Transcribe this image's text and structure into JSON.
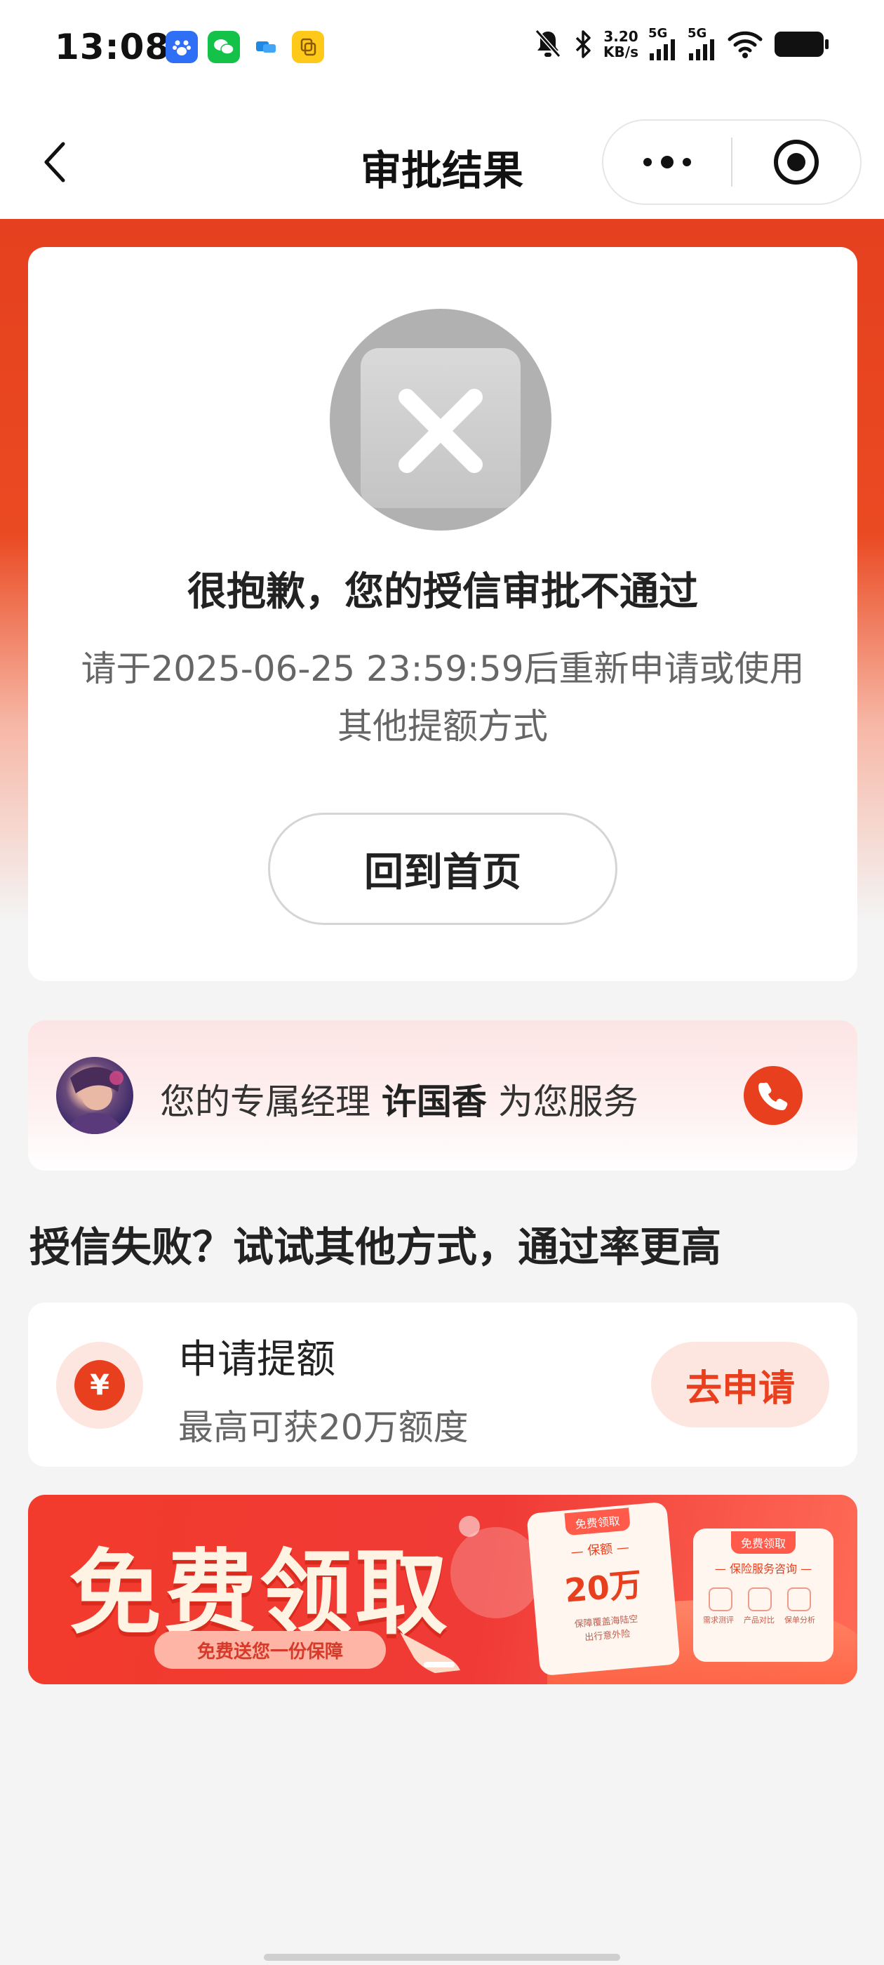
{
  "status_bar": {
    "time": "13:08",
    "speed_value": "3.20",
    "speed_unit": "KB/s",
    "net1": "5G",
    "net2": "5G"
  },
  "nav": {
    "title": "审批结果"
  },
  "result": {
    "message": "很抱歉，您的授信审批不通过",
    "sub_line1": "请于2025-06-25 23:59:59后重新申请或使用",
    "sub_line2": "其他提额方式",
    "home_button": "回到首页"
  },
  "manager": {
    "prefix": "您的专属经理 ",
    "name": "许国香",
    "suffix": " 为您服务"
  },
  "section": {
    "title": "授信失败？试试其他方式，通过率更高"
  },
  "apply": {
    "icon_symbol": "¥",
    "title": "申请提额",
    "subtitle": "最高可获20万额度",
    "button": "去申请"
  },
  "banner": {
    "headline": "免费领取",
    "pill": "免费送您一份保障",
    "card1_tag": "免费领取",
    "card1_line": "— 保额 —",
    "card1_amount": "20万",
    "card1_tiny1": "保障覆盖海陆空",
    "card1_tiny2": "出行意外险",
    "card2_tag": "免费领取",
    "card2_line": "— 保险服务咨询 —",
    "card2_labels": [
      "需求测评",
      "产品对比",
      "保单分析"
    ]
  },
  "colors": {
    "brand_red": "#e8401e",
    "bg": "#f4f4f4"
  }
}
